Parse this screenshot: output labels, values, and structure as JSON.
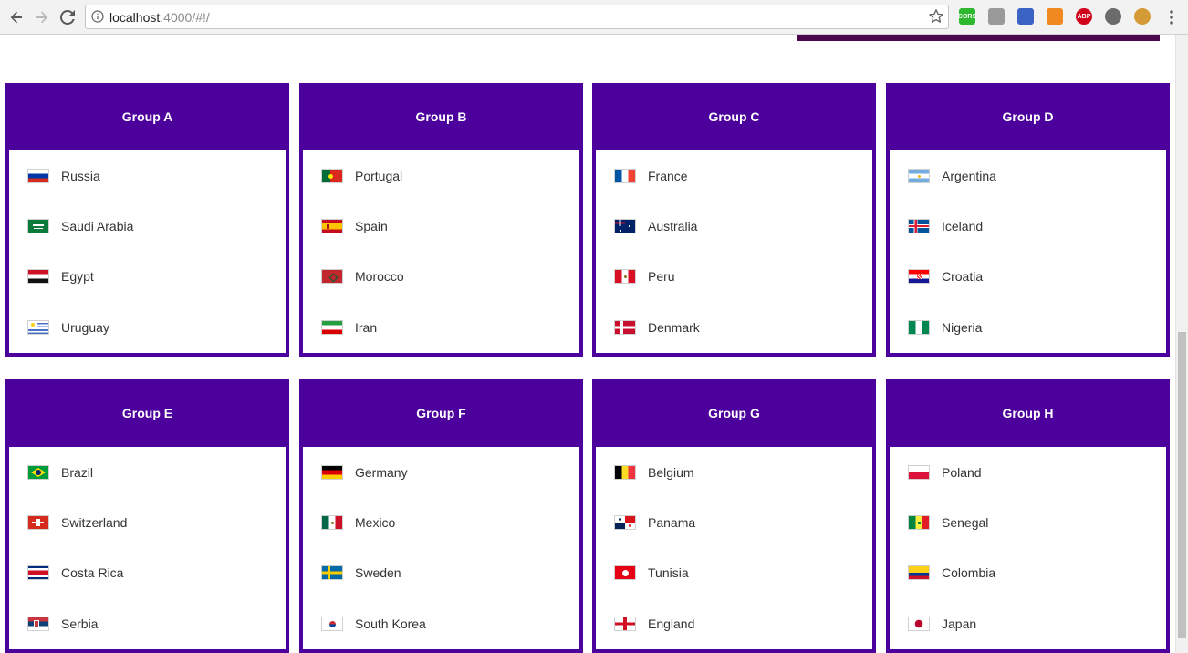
{
  "browser": {
    "url_host": "localhost",
    "url_rest": ":4000/#!/",
    "extensions": [
      {
        "name": "cors-extension-icon",
        "label": "CORS",
        "color": "#2eb82e"
      },
      {
        "name": "screenshot-extension-icon",
        "label": "",
        "color": "#9a9a9a"
      },
      {
        "name": "eyedropper-extension-icon",
        "label": "",
        "color": "#3b63c4"
      },
      {
        "name": "metamask-extension-icon",
        "label": "",
        "color": "#f0891f"
      },
      {
        "name": "adblock-extension-icon",
        "label": "ABP",
        "color": "#d0021b"
      },
      {
        "name": "circle-extension-icon",
        "label": "",
        "color": "#6b6b6b"
      },
      {
        "name": "cookie-extension-icon",
        "label": "",
        "color": "#d39a35"
      }
    ]
  },
  "groups": [
    {
      "title": "Group A",
      "teams": [
        {
          "name": "Russia",
          "flag": "russia"
        },
        {
          "name": "Saudi Arabia",
          "flag": "saudi"
        },
        {
          "name": "Egypt",
          "flag": "egypt"
        },
        {
          "name": "Uruguay",
          "flag": "uruguay"
        }
      ]
    },
    {
      "title": "Group B",
      "teams": [
        {
          "name": "Portugal",
          "flag": "portugal"
        },
        {
          "name": "Spain",
          "flag": "spain"
        },
        {
          "name": "Morocco",
          "flag": "morocco"
        },
        {
          "name": "Iran",
          "flag": "iran"
        }
      ]
    },
    {
      "title": "Group C",
      "teams": [
        {
          "name": "France",
          "flag": "france"
        },
        {
          "name": "Australia",
          "flag": "australia"
        },
        {
          "name": "Peru",
          "flag": "peru"
        },
        {
          "name": "Denmark",
          "flag": "denmark"
        }
      ]
    },
    {
      "title": "Group D",
      "teams": [
        {
          "name": "Argentina",
          "flag": "argentina"
        },
        {
          "name": "Iceland",
          "flag": "iceland"
        },
        {
          "name": "Croatia",
          "flag": "croatia"
        },
        {
          "name": "Nigeria",
          "flag": "nigeria"
        }
      ]
    },
    {
      "title": "Group E",
      "teams": [
        {
          "name": "Brazil",
          "flag": "brazil"
        },
        {
          "name": "Switzerland",
          "flag": "switzerland"
        },
        {
          "name": "Costa Rica",
          "flag": "costarica"
        },
        {
          "name": "Serbia",
          "flag": "serbia"
        }
      ]
    },
    {
      "title": "Group F",
      "teams": [
        {
          "name": "Germany",
          "flag": "germany"
        },
        {
          "name": "Mexico",
          "flag": "mexico"
        },
        {
          "name": "Sweden",
          "flag": "sweden"
        },
        {
          "name": "South Korea",
          "flag": "southkorea"
        }
      ]
    },
    {
      "title": "Group G",
      "teams": [
        {
          "name": "Belgium",
          "flag": "belgium"
        },
        {
          "name": "Panama",
          "flag": "panama"
        },
        {
          "name": "Tunisia",
          "flag": "tunisia"
        },
        {
          "name": "England",
          "flag": "england"
        }
      ]
    },
    {
      "title": "Group H",
      "teams": [
        {
          "name": "Poland",
          "flag": "poland"
        },
        {
          "name": "Senegal",
          "flag": "senegal"
        },
        {
          "name": "Colombia",
          "flag": "colombia"
        },
        {
          "name": "Japan",
          "flag": "japan"
        }
      ]
    }
  ]
}
